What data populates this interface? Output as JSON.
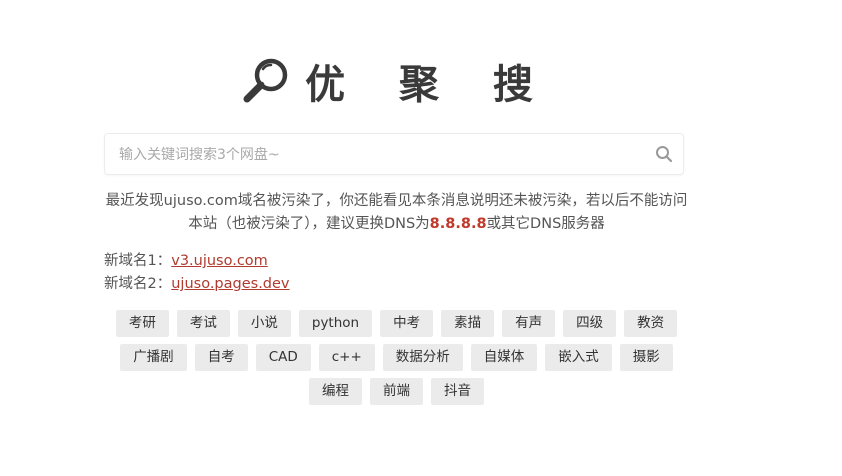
{
  "logo": {
    "icon": "magnifier-icon",
    "title": "优 聚 搜"
  },
  "search": {
    "placeholder": "输入关键词搜索3个网盘~",
    "value": "",
    "icon": "search-icon"
  },
  "notice": {
    "text_before": "最近发现ujuso.com域名被污染了，你还能看见本条消息说明还未被污染，若以后不能访问本站（也被污染了），建议更换DNS为",
    "dns": "8.8.8.8",
    "text_after": "或其它DNS服务器",
    "dns_color": "#c0392b"
  },
  "domains": [
    {
      "label": "新域名1：",
      "link": "v3.ujuso.com"
    },
    {
      "label": "新域名2：",
      "link": "ujuso.pages.dev"
    }
  ],
  "tags": [
    [
      "考研",
      "考试",
      "小说",
      "python",
      "中考",
      "素描",
      "有声",
      "四级",
      "教资"
    ],
    [
      "广播剧",
      "自考",
      "CAD",
      "c++",
      "数据分析",
      "自媒体",
      "嵌入式",
      "摄影"
    ],
    [
      "编程",
      "前端",
      "抖音"
    ]
  ]
}
